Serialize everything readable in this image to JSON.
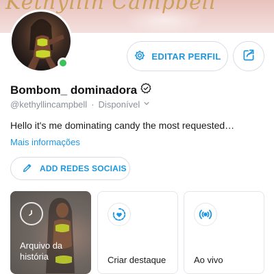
{
  "cover": {
    "script_text": "Kethyllin Campbell"
  },
  "profile": {
    "display_name": "Bombom_ dominadora",
    "handle": "@kethyllincampbell",
    "status": "Disponível",
    "bio": "Hello it's me dominating candy the most requested…",
    "more_info_label": "Mais informações",
    "online": true
  },
  "actions": {
    "edit_profile_label": "EDITAR PERFIL",
    "add_social_label": "ADD REDES SOCIAIS"
  },
  "cards": {
    "archive_label": "Arquivo da história",
    "highlight_label": "Criar destaque",
    "live_label": "Ao vivo"
  },
  "icons": {
    "edit": "gear-icon",
    "share": "share-icon",
    "verified": "verified-badge-icon",
    "dropdown": "chevron-down-icon",
    "pencil": "pencil-icon",
    "archive": "clock-history-icon",
    "highlight": "heart-circle-icon",
    "live": "broadcast-icon"
  },
  "colors": {
    "accent": "#1c96e0",
    "online": "#39c15a"
  }
}
